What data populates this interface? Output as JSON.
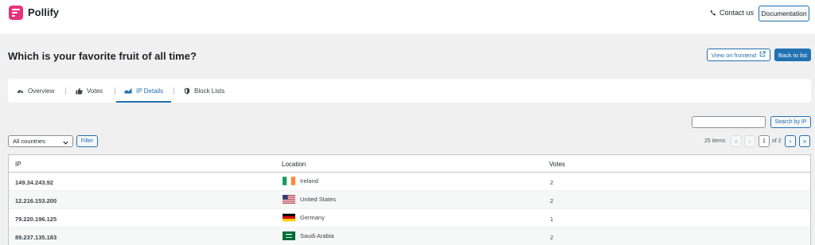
{
  "header": {
    "app_name": "Pollify",
    "contact_label": "Contact us",
    "documentation_label": "Documentation"
  },
  "page": {
    "title": "Which is your favorite fruit of all time?",
    "view_frontend_label": "View on frontend",
    "back_label": "Back to list"
  },
  "tabs": [
    {
      "label": "Overview",
      "icon": "dashboard-icon",
      "active": false
    },
    {
      "label": "Votes",
      "icon": "thumbs-up-icon",
      "active": false
    },
    {
      "label": "IP Details",
      "icon": "chart-icon",
      "active": true
    },
    {
      "label": "Block Lists",
      "icon": "shield-icon",
      "active": false
    }
  ],
  "search": {
    "value": "",
    "button_label": "Search by IP"
  },
  "filter": {
    "selected_country": "All countries",
    "button_label": "Filter"
  },
  "pagination": {
    "items_text": "25 items",
    "first": "«",
    "prev": "‹",
    "current_page": "1",
    "of_text": "of 2",
    "next": "›",
    "last": "»"
  },
  "table": {
    "columns": [
      "IP",
      "Location",
      "Votes"
    ],
    "rows": [
      {
        "ip": "149.34.243.92",
        "country": "Ireland",
        "flag": "ireland-flag-icon",
        "votes": "2"
      },
      {
        "ip": "12.216.153.200",
        "country": "United States",
        "flag": "us-flag-icon",
        "votes": "2"
      },
      {
        "ip": "79.220.196.125",
        "country": "Germany",
        "flag": "germany-flag-icon",
        "votes": "1"
      },
      {
        "ip": "89.237.135.183",
        "country": "Saudi Arabia",
        "flag": "saudi-flag-icon",
        "votes": "2"
      }
    ]
  },
  "colors": {
    "accent": "#2271b1",
    "brand": "#e8327d",
    "background": "#f0f0f1"
  }
}
